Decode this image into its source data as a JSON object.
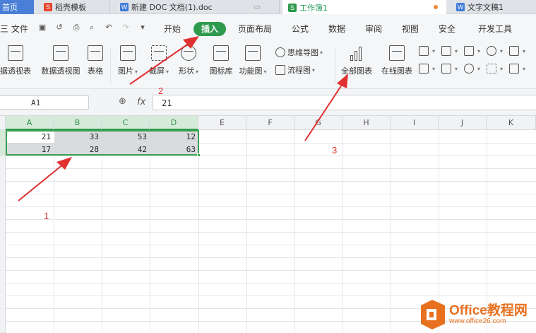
{
  "tabs": [
    {
      "label": "首页",
      "icon": "home-icon"
    },
    {
      "label": "稻壳模板",
      "icon": "docer-icon"
    },
    {
      "label": "新建 DOC 文档(1).doc",
      "icon": "word-doc-icon"
    },
    {
      "label": "工作簿1",
      "icon": "spreadsheet-icon",
      "active": true
    },
    {
      "label": "文字文稿1",
      "icon": "word-doc-icon"
    }
  ],
  "menu": {
    "file": "三 文件",
    "items": [
      "开始",
      "插入",
      "页面布局",
      "公式",
      "数据",
      "审阅",
      "视图",
      "安全",
      "开发工具"
    ],
    "active": "插入"
  },
  "ribbon": {
    "pivot_table": "据透视表",
    "pivot_chart": "数据透视图",
    "table": "表格",
    "picture": "图片",
    "screenshot": "截屏",
    "shapes": "形状",
    "icon_lib": "图标库",
    "function_chart": "功能图",
    "mind_map": "思维导图",
    "flowchart": "流程图",
    "all_charts": "全部图表",
    "online_charts": "在线图表"
  },
  "formula_bar": {
    "name_box": "A1",
    "fx": "fx",
    "value": "21"
  },
  "sheet": {
    "columns": [
      "A",
      "B",
      "C",
      "D",
      "E",
      "F",
      "G",
      "H",
      "I",
      "J",
      "K"
    ],
    "rows": [
      [
        "21",
        "33",
        "53",
        "12"
      ],
      [
        "17",
        "28",
        "42",
        "63"
      ]
    ]
  },
  "annotations": {
    "step1": "1",
    "step2": "2",
    "step3": "3"
  },
  "watermark": {
    "title": "Office教程网",
    "url": "www.office26.com"
  },
  "colors": {
    "accent_green": "#2e9a4e",
    "arrow_red": "#e03030",
    "watermark_orange": "#e8711f"
  }
}
